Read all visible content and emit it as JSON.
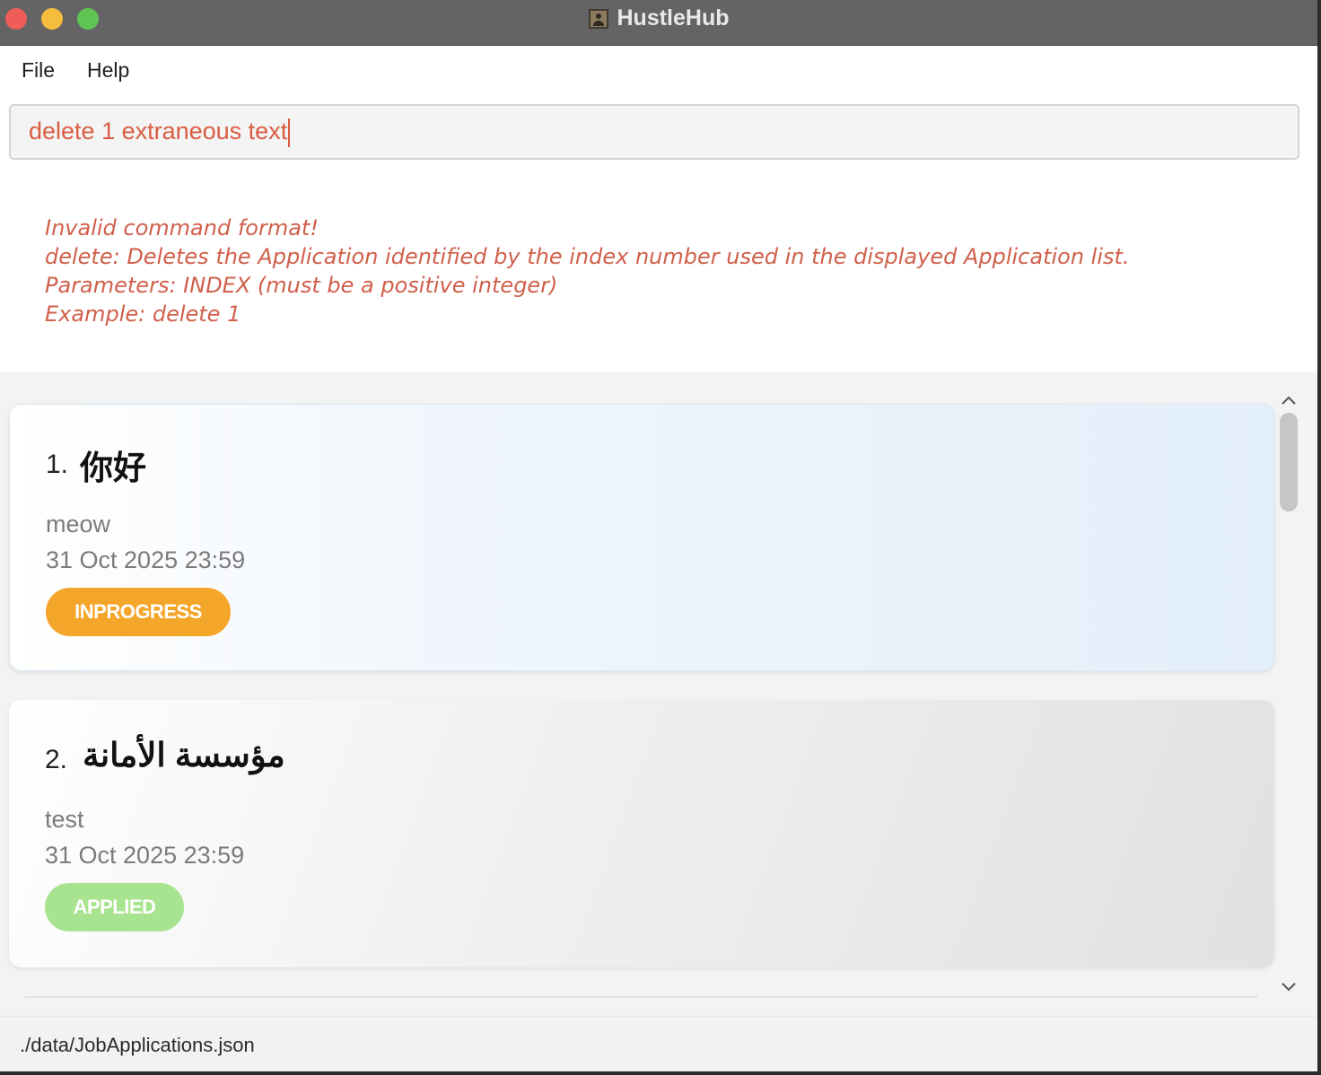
{
  "window": {
    "title": "HustleHub"
  },
  "menu": {
    "file": "File",
    "help": "Help"
  },
  "command": {
    "value": "delete 1 extraneous text"
  },
  "result": {
    "lines": [
      "Invalid command format!",
      "delete: Deletes the Application identified by the index number used in the displayed Application list.",
      "Parameters: INDEX (must be a positive integer)",
      "Example: delete 1"
    ]
  },
  "applications": [
    {
      "index": "1.",
      "company": "你好",
      "role": "meow",
      "deadline": "31 Oct 2025 23:59",
      "status": "INPROGRESS"
    },
    {
      "index": "2.",
      "company": "مؤسسة الأمانة",
      "role": "test",
      "deadline": "31 Oct 2025 23:59",
      "status": "APPLIED"
    }
  ],
  "status_bar": {
    "path": "./data/JobApplications.json"
  },
  "colors": {
    "inprogress": "#f4a62a",
    "applied": "#a8e48f",
    "error_text": "#d0604b",
    "command_text": "#d95c43"
  },
  "icons": {
    "app": "person-portrait-icon",
    "scroll_up": "chevron-up-icon",
    "scroll_down": "chevron-down-icon"
  }
}
